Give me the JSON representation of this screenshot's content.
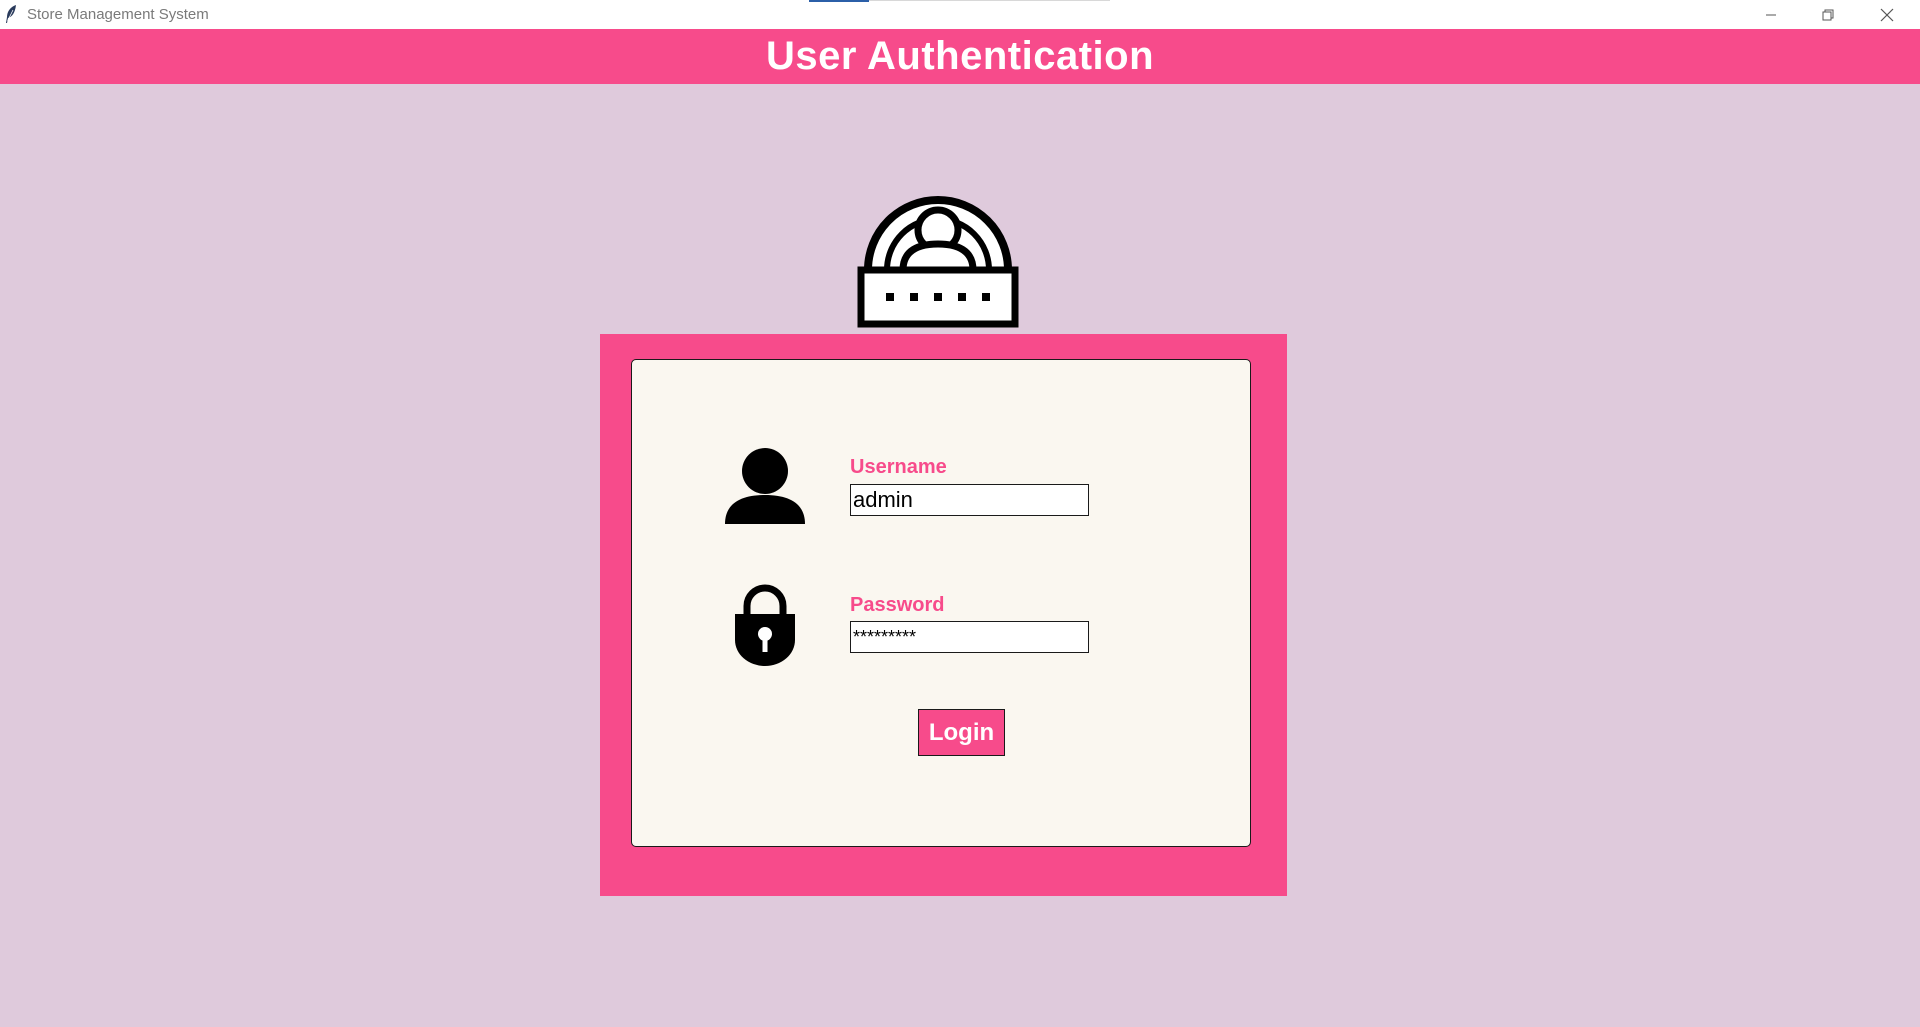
{
  "window": {
    "title": "Store Management System",
    "icon": "feather-icon",
    "controls": [
      "minimize-icon",
      "restore-icon",
      "close-icon"
    ]
  },
  "header": {
    "title": "User Authentication",
    "background": "#f74b8b"
  },
  "login_form": {
    "username_label": "Username",
    "username_value": "admin",
    "password_label": "Password",
    "password_value": "*********",
    "login_label": "Login"
  },
  "icons": {
    "auth": "user-authentication-icon",
    "user": "user-icon",
    "password": "lock-icon"
  },
  "colors": {
    "accent": "#f74b8b",
    "page_background": "#dfcadc",
    "card_background": "#faf7f0"
  }
}
